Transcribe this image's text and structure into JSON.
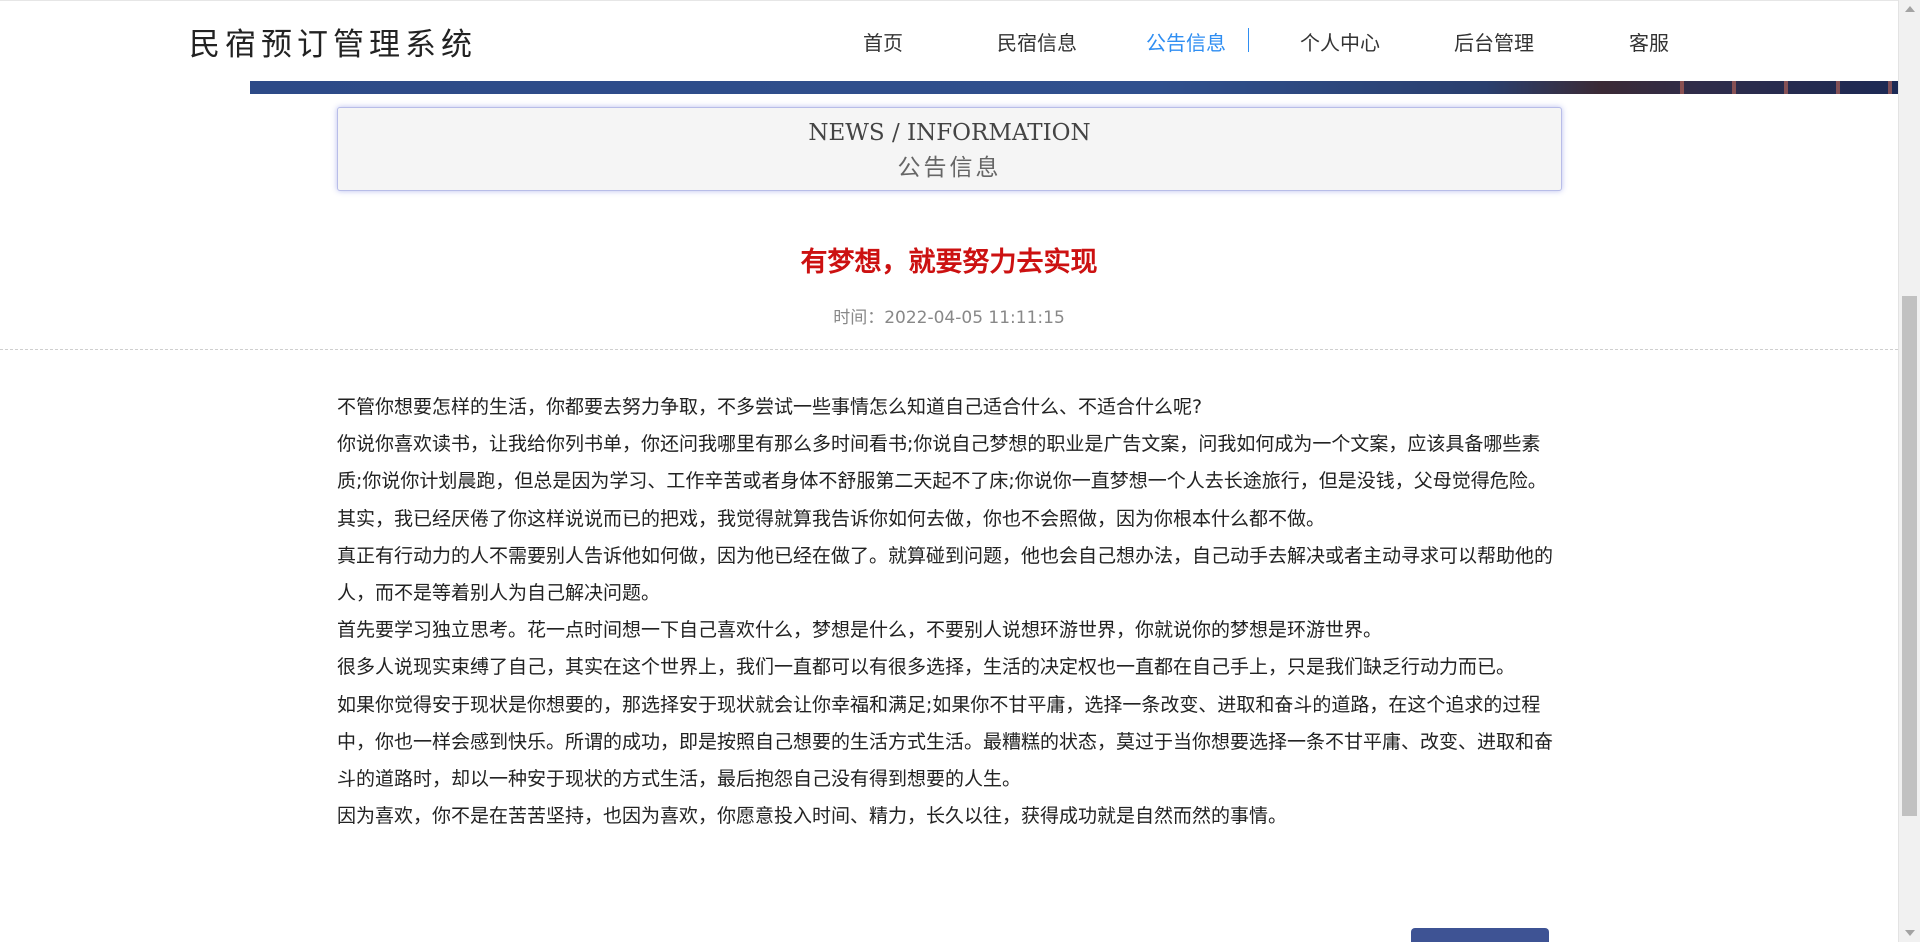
{
  "header": {
    "logo": "民宿预订管理系统",
    "nav": [
      {
        "label": "首页"
      },
      {
        "label": "民宿信息"
      },
      {
        "label": "公告信息",
        "active": true
      },
      {
        "label": "个人中心"
      },
      {
        "label": "后台管理"
      },
      {
        "label": "客服"
      }
    ],
    "accent_color": "#2f8ef2"
  },
  "section": {
    "title_en": "NEWS / INFORMATION",
    "title_cn": "公告信息"
  },
  "article": {
    "title": "有梦想，就要努力去实现",
    "time": "时间：2022-04-05 11:11:15",
    "title_color": "#cc1111",
    "paragraphs": [
      "不管你想要怎样的生活，你都要去努力争取，不多尝试一些事情怎么知道自己适合什么、不适合什么呢?",
      "你说你喜欢读书，让我给你列书单，你还问我哪里有那么多时间看书;你说自己梦想的职业是广告文案，问我如何成为一个文案，应该具备哪些素质;你说你计划晨跑，但总是因为学习、工作辛苦或者身体不舒服第二天起不了床;你说你一直梦想一个人去长途旅行，但是没钱，父母觉得危险。其实，我已经厌倦了你这样说说而已的把戏，我觉得就算我告诉你如何去做，你也不会照做，因为你根本什么都不做。",
      "真正有行动力的人不需要别人告诉他如何做，因为他已经在做了。就算碰到问题，他也会自己想办法，自己动手去解决或者主动寻求可以帮助他的人，而不是等着别人为自己解决问题。",
      "首先要学习独立思考。花一点时间想一下自己喜欢什么，梦想是什么，不要别人说想环游世界，你就说你的梦想是环游世界。",
      "很多人说现实束缚了自己，其实在这个世界上，我们一直都可以有很多选择，生活的决定权也一直都在自己手上，只是我们缺乏行动力而已。",
      "如果你觉得安于现状是你想要的，那选择安于现状就会让你幸福和满足;如果你不甘平庸，选择一条改变、进取和奋斗的道路，在这个追求的过程中，你也一样会感到快乐。所谓的成功，即是按照自己想要的生活方式生活。最糟糕的状态，莫过于当你想要选择一条不甘平庸、改变、进取和奋斗的道路时，却以一种安于现状的方式生活，最后抱怨自己没有得到想要的人生。",
      "因为喜欢，你不是在苦苦坚持，也因为喜欢，你愿意投入时间、精力，长久以往，获得成功就是自然而然的事情。"
    ]
  },
  "button_color": "#3e5394"
}
